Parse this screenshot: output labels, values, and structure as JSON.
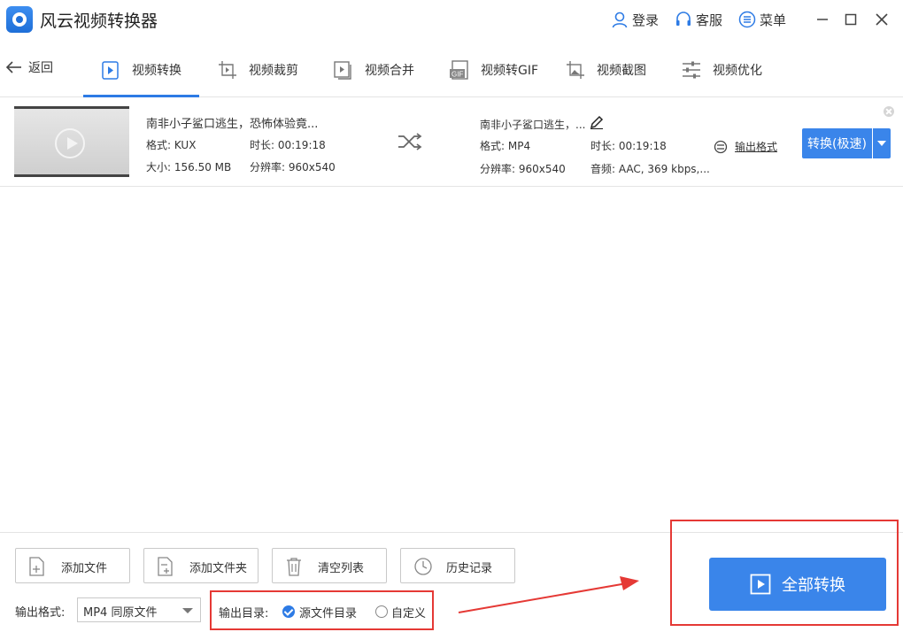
{
  "app": {
    "title": "风云视频转换器"
  },
  "titlebar": {
    "login": "登录",
    "service": "客服",
    "menu": "菜单"
  },
  "nav": {
    "back": "返回",
    "tabs": [
      {
        "label": "视频转换",
        "active": true
      },
      {
        "label": "视频裁剪"
      },
      {
        "label": "视频合并"
      },
      {
        "label": "视频转GIF"
      },
      {
        "label": "视频截图"
      },
      {
        "label": "视频优化"
      }
    ]
  },
  "file": {
    "source": {
      "name": "南非小子鲨口逃生，恐怖体验竟...",
      "format": "格式: KUX",
      "duration": "时长: 00:19:18",
      "size": "大小: 156.50 MB",
      "resolution": "分辨率: 960x540"
    },
    "output": {
      "name": "南非小子鲨口逃生，...",
      "format": "格式: MP4",
      "duration": "时长: 00:19:18",
      "resolution": "分辨率: 960x540",
      "audio": "音频: AAC, 369 kbps,..."
    },
    "output_format_link": "输出格式",
    "convert_button": "转换(极速)"
  },
  "bottom": {
    "buttons": [
      "添加文件",
      "添加文件夹",
      "清空列表",
      "历史记录"
    ],
    "format_label": "输出格式:",
    "format_value": "MP4 同原文件",
    "dir_label": "输出目录:",
    "dir_options": {
      "source": "源文件目录",
      "custom": "自定义",
      "selected": "source"
    },
    "convert_all": "全部转换"
  },
  "colors": {
    "accent": "#3a85ea",
    "highlight": "#e53935"
  }
}
